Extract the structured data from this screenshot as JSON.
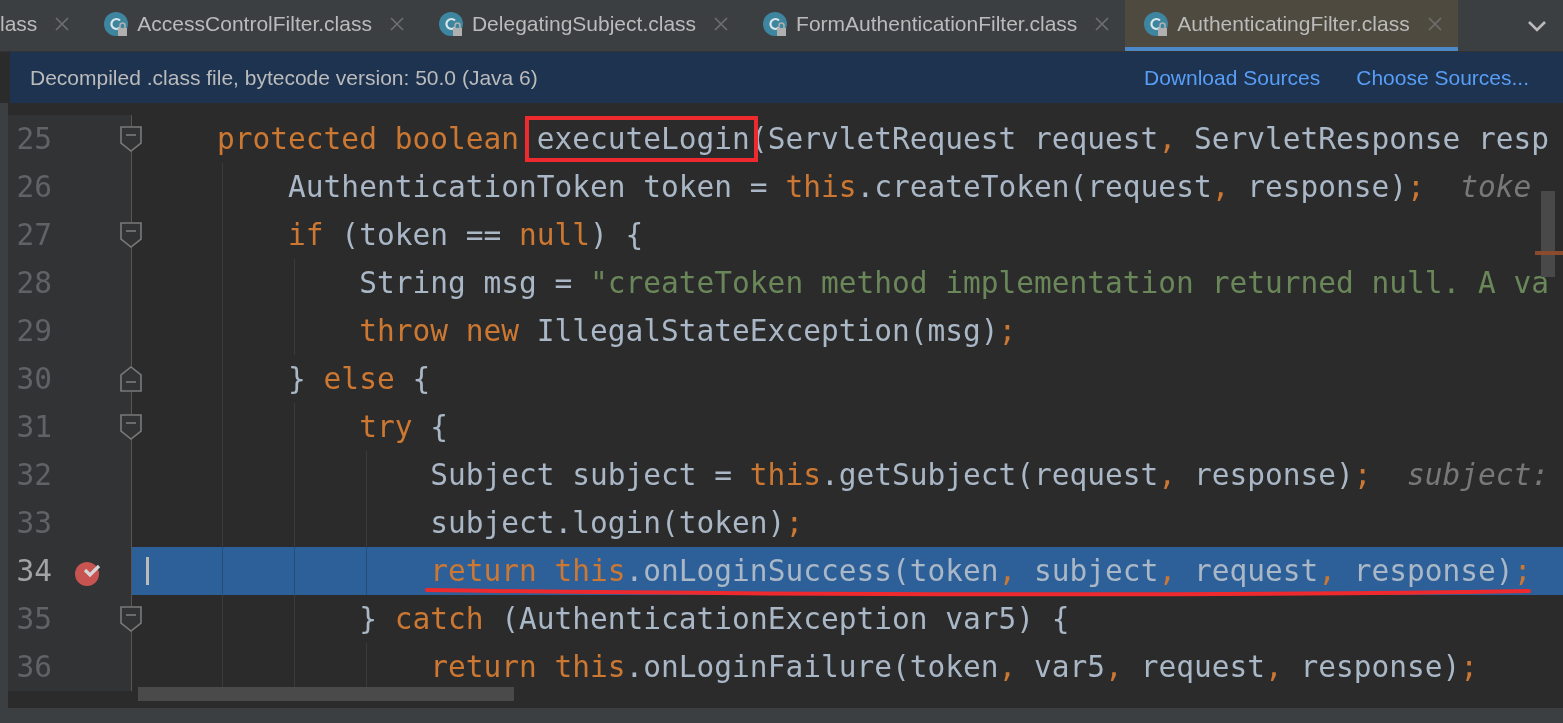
{
  "tabs": [
    {
      "label": "lass",
      "selected": false
    },
    {
      "label": "AccessControlFilter.class",
      "selected": false
    },
    {
      "label": "DelegatingSubject.class",
      "selected": false
    },
    {
      "label": "FormAuthenticationFilter.class",
      "selected": false
    },
    {
      "label": "AuthenticatingFilter.class",
      "selected": true
    }
  ],
  "info_bar": {
    "message": "Decompiled .class file, bytecode version: 50.0 (Java 6)",
    "links": [
      "Download Sources",
      "Choose Sources..."
    ]
  },
  "lines": [
    {
      "number": "25",
      "fold_start": true,
      "fold_end": false,
      "breakpoint": false,
      "current": false,
      "underlined": false,
      "tokens": [
        {
          "kind": "keyword",
          "text": "    protected boolean "
        },
        {
          "kind": "plain",
          "text": "executeLogin",
          "boxed": true
        },
        {
          "kind": "plain",
          "text": "(ServletRequest request"
        },
        {
          "kind": "keyword",
          "text": ", "
        },
        {
          "kind": "plain",
          "text": "ServletResponse resp"
        }
      ]
    },
    {
      "number": "26",
      "fold_start": false,
      "fold_end": false,
      "breakpoint": false,
      "current": false,
      "underlined": false,
      "tokens": [
        {
          "kind": "plain",
          "text": "        AuthenticationToken token = "
        },
        {
          "kind": "keyword",
          "text": "this"
        },
        {
          "kind": "plain",
          "text": ".createToken(request"
        },
        {
          "kind": "keyword",
          "text": ", "
        },
        {
          "kind": "plain",
          "text": "response)"
        },
        {
          "kind": "keyword",
          "text": ";"
        },
        {
          "kind": "hint",
          "text": "  toke"
        }
      ]
    },
    {
      "number": "27",
      "fold_start": true,
      "fold_end": false,
      "breakpoint": false,
      "current": false,
      "underlined": false,
      "tokens": [
        {
          "kind": "keyword",
          "text": "        if"
        },
        {
          "kind": "plain",
          "text": " (token == "
        },
        {
          "kind": "keyword",
          "text": "null"
        },
        {
          "kind": "plain",
          "text": ") {"
        }
      ]
    },
    {
      "number": "28",
      "fold_start": false,
      "fold_end": false,
      "breakpoint": false,
      "current": false,
      "underlined": false,
      "tokens": [
        {
          "kind": "plain",
          "text": "            String msg = "
        },
        {
          "kind": "string",
          "text": "\"createToken method implementation returned null. A va"
        }
      ]
    },
    {
      "number": "29",
      "fold_start": false,
      "fold_end": false,
      "breakpoint": false,
      "current": false,
      "underlined": false,
      "tokens": [
        {
          "kind": "keyword",
          "text": "            throw new "
        },
        {
          "kind": "plain",
          "text": "IllegalStateException(msg)"
        },
        {
          "kind": "keyword",
          "text": ";"
        }
      ]
    },
    {
      "number": "30",
      "fold_start": false,
      "fold_end": true,
      "breakpoint": false,
      "current": false,
      "underlined": false,
      "tokens": [
        {
          "kind": "plain",
          "text": "        } "
        },
        {
          "kind": "keyword",
          "text": "else"
        },
        {
          "kind": "plain",
          "text": " {"
        }
      ]
    },
    {
      "number": "31",
      "fold_start": true,
      "fold_end": false,
      "breakpoint": false,
      "current": false,
      "underlined": false,
      "tokens": [
        {
          "kind": "keyword",
          "text": "            try"
        },
        {
          "kind": "plain",
          "text": " {"
        }
      ]
    },
    {
      "number": "32",
      "fold_start": false,
      "fold_end": false,
      "breakpoint": false,
      "current": false,
      "underlined": false,
      "tokens": [
        {
          "kind": "plain",
          "text": "                Subject subject = "
        },
        {
          "kind": "keyword",
          "text": "this"
        },
        {
          "kind": "plain",
          "text": ".getSubject(request"
        },
        {
          "kind": "keyword",
          "text": ", "
        },
        {
          "kind": "plain",
          "text": "response)"
        },
        {
          "kind": "keyword",
          "text": ";"
        },
        {
          "kind": "hint",
          "text": "  subject:"
        }
      ]
    },
    {
      "number": "33",
      "fold_start": false,
      "fold_end": false,
      "breakpoint": false,
      "current": false,
      "underlined": false,
      "tokens": [
        {
          "kind": "plain",
          "text": "                subject.login(token)"
        },
        {
          "kind": "keyword",
          "text": ";"
        }
      ]
    },
    {
      "number": "34",
      "fold_start": false,
      "fold_end": false,
      "breakpoint": true,
      "current": true,
      "underlined": true,
      "tokens": [
        {
          "kind": "keyword",
          "text": "                return this"
        },
        {
          "kind": "plain",
          "text": ".onLoginSuccess(token"
        },
        {
          "kind": "keyword",
          "text": ", "
        },
        {
          "kind": "plain",
          "text": "subject"
        },
        {
          "kind": "keyword",
          "text": ", "
        },
        {
          "kind": "plain",
          "text": "request"
        },
        {
          "kind": "keyword",
          "text": ", "
        },
        {
          "kind": "plain",
          "text": "response)"
        },
        {
          "kind": "keyword",
          "text": ";"
        }
      ]
    },
    {
      "number": "35",
      "fold_start": true,
      "fold_end": false,
      "breakpoint": false,
      "current": false,
      "underlined": false,
      "tokens": [
        {
          "kind": "plain",
          "text": "            } "
        },
        {
          "kind": "keyword",
          "text": "catch"
        },
        {
          "kind": "plain",
          "text": " (AuthenticationException var5) {"
        }
      ]
    },
    {
      "number": "36",
      "fold_start": false,
      "fold_end": false,
      "breakpoint": false,
      "current": false,
      "underlined": false,
      "tokens": [
        {
          "kind": "keyword",
          "text": "                return this"
        },
        {
          "kind": "plain",
          "text": ".onLoginFailure(token"
        },
        {
          "kind": "keyword",
          "text": ", "
        },
        {
          "kind": "plain",
          "text": "var5"
        },
        {
          "kind": "keyword",
          "text": ", "
        },
        {
          "kind": "plain",
          "text": "request"
        },
        {
          "kind": "keyword",
          "text": ", "
        },
        {
          "kind": "plain",
          "text": "response)"
        },
        {
          "kind": "keyword",
          "text": ";"
        }
      ]
    }
  ]
}
